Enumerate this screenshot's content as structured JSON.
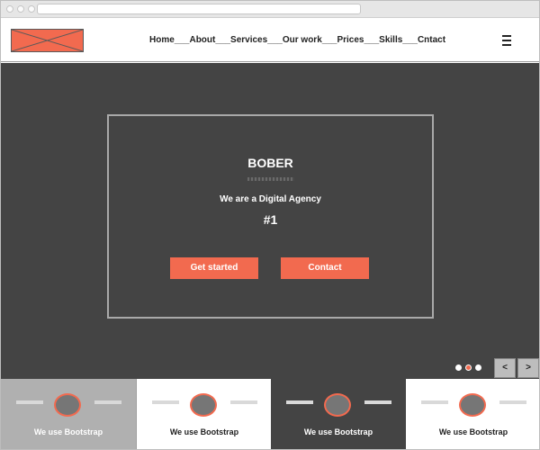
{
  "header": {
    "nav_text": "Home___About___Services___Our work___Prices___Skills___Cntact"
  },
  "hero": {
    "title": "BOBER",
    "subtitle": "We are a Digital Agency",
    "rank": "#1",
    "primary_button": "Get started",
    "secondary_button": "Contact"
  },
  "slider": {
    "prev_label": "<",
    "next_label": ">",
    "active_index": 2,
    "count": 3
  },
  "features": [
    {
      "label": "We use Bootstrap"
    },
    {
      "label": "We use Bootstrap"
    },
    {
      "label": "We use Bootstrap"
    },
    {
      "label": "We use Bootstrap"
    }
  ],
  "colors": {
    "accent": "#f26a4f",
    "hero_bg": "#444444",
    "card_gray": "#b0b0b0"
  },
  "icons": {
    "logo": "placeholder-image-icon",
    "menu": "hamburger-menu-icon"
  }
}
